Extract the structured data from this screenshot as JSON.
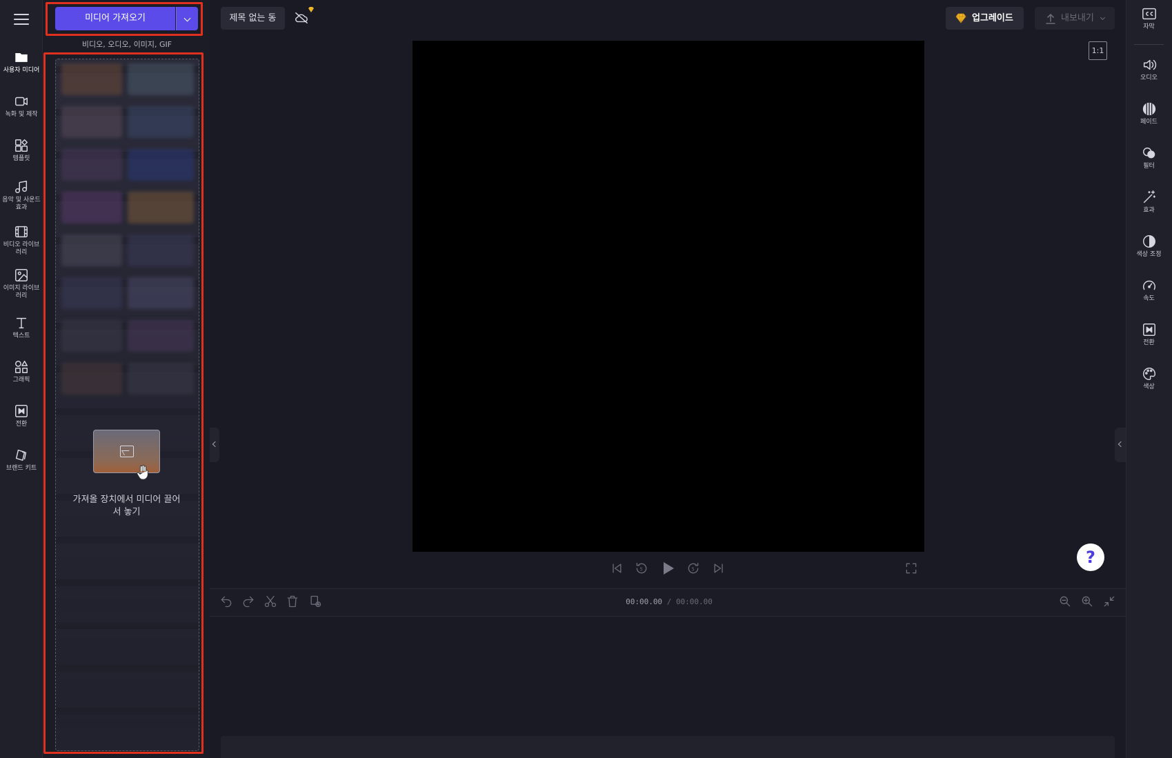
{
  "left_rail": {
    "items": [
      {
        "label": "사용자 미디어",
        "icon": "folder-icon"
      },
      {
        "label": "녹화 및 제작",
        "icon": "camera-icon"
      },
      {
        "label": "템플릿",
        "icon": "template-icon"
      },
      {
        "label": "음악 및 사운드 효과",
        "icon": "music-note-icon"
      },
      {
        "label": "비디오 라이브러리",
        "icon": "film-icon"
      },
      {
        "label": "이미지 라이브러리",
        "icon": "image-icon"
      },
      {
        "label": "텍스트",
        "icon": "text-icon"
      },
      {
        "label": "그래픽",
        "icon": "shapes-icon"
      },
      {
        "label": "전환",
        "icon": "transition-icon"
      },
      {
        "label": "브랜드 키트",
        "icon": "brand-kit-icon"
      }
    ]
  },
  "media_panel": {
    "import_label": "미디어 가져오기",
    "import_subtitle": "비디오, 오디오, 이미지, GIF",
    "drop_text": "가져올 장치에서 미디어 끌어서 놓기"
  },
  "topbar": {
    "project_title": "제목 없는 동",
    "upgrade_label": "업그레이드",
    "export_label": "내보내기"
  },
  "preview": {
    "aspect_ratio": "1:1",
    "help_label": "?"
  },
  "timeline": {
    "current_time": "00:00.00",
    "separator": "/",
    "total_time": "00:00.00"
  },
  "right_rail": {
    "items": [
      {
        "label": "자막",
        "icon": "cc-icon"
      },
      {
        "label": "오디오",
        "icon": "speaker-icon"
      },
      {
        "label": "페이드",
        "icon": "fade-icon"
      },
      {
        "label": "필터",
        "icon": "filter-icon"
      },
      {
        "label": "효과",
        "icon": "magic-wand-icon"
      },
      {
        "label": "색상 조정",
        "icon": "contrast-icon"
      },
      {
        "label": "속도",
        "icon": "speedometer-icon"
      },
      {
        "label": "전환",
        "icon": "transition-icon"
      },
      {
        "label": "색상",
        "icon": "palette-icon"
      }
    ]
  },
  "colors": {
    "accent": "#5b4be8",
    "highlight": "#e0301e",
    "background": "#1a1a24",
    "panel": "#20202b"
  }
}
